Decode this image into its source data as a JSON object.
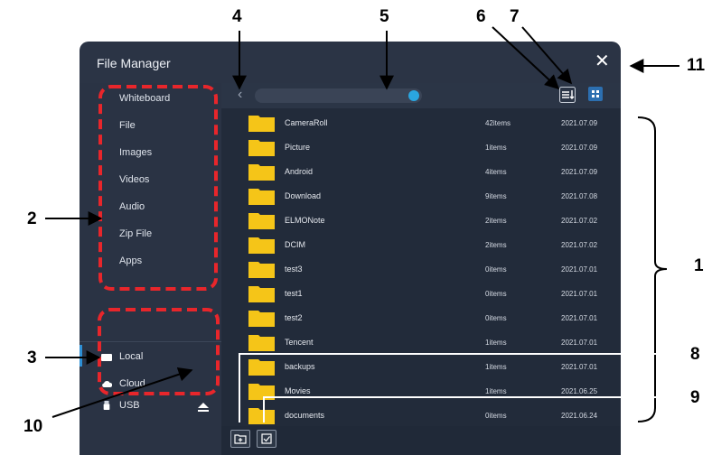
{
  "window": {
    "title": "File Manager",
    "close_icon": "close-icon"
  },
  "sidebar": {
    "categories": [
      "Whiteboard",
      "File",
      "Images",
      "Videos",
      "Audio",
      "Zip File",
      "Apps"
    ],
    "storage": [
      {
        "label": "Local",
        "icon": "drive-icon"
      },
      {
        "label": "Cloud",
        "icon": "cloud-icon"
      },
      {
        "label": "USB",
        "icon": "usb-icon"
      }
    ],
    "eject_icon": "eject-icon"
  },
  "toolbar": {
    "back_icon": "chevron-left-icon",
    "search_icon": "search-icon",
    "sort_icon": "sort-icon",
    "grid_icon": "grid-view-icon"
  },
  "files": [
    {
      "name": "CameraRoll",
      "count": "42items",
      "date": "2021.07.09"
    },
    {
      "name": "Picture",
      "count": "1items",
      "date": "2021.07.09"
    },
    {
      "name": "Android",
      "count": "4items",
      "date": "2021.07.09"
    },
    {
      "name": "Download",
      "count": "9items",
      "date": "2021.07.08"
    },
    {
      "name": "ELMONote",
      "count": "2items",
      "date": "2021.07.02"
    },
    {
      "name": "DCIM",
      "count": "2items",
      "date": "2021.07.02"
    },
    {
      "name": "test3",
      "count": "0items",
      "date": "2021.07.01"
    },
    {
      "name": "test1",
      "count": "0items",
      "date": "2021.07.01"
    },
    {
      "name": "test2",
      "count": "0items",
      "date": "2021.07.01"
    },
    {
      "name": "Tencent",
      "count": "1items",
      "date": "2021.07.01"
    },
    {
      "name": "backups",
      "count": "1items",
      "date": "2021.07.01"
    },
    {
      "name": "Movies",
      "count": "1items",
      "date": "2021.06.25"
    },
    {
      "name": "documents",
      "count": "0items",
      "date": "2021.06.24"
    }
  ],
  "bottombar": {
    "new_folder_icon": "new-folder-icon",
    "select_icon": "select-checkbox-icon"
  },
  "callouts": [
    "1",
    "2",
    "3",
    "4",
    "5",
    "6",
    "7",
    "8",
    "9",
    "10",
    "11"
  ],
  "colors": {
    "window_bg": "#2b3445",
    "list_bg": "#222b3a",
    "folder": "#f5c518",
    "annotation_red": "#e8262b",
    "accent": "#2d8fd5"
  }
}
